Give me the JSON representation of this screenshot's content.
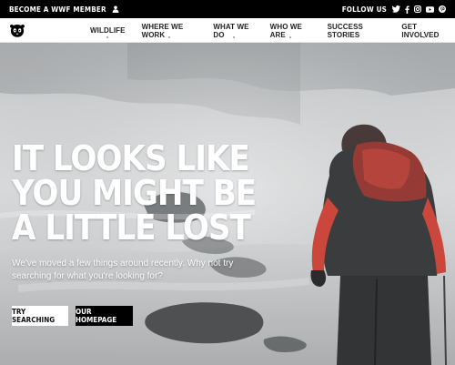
{
  "topbar": {
    "member_label": "BECOME A WWF MEMBER",
    "follow_label": "FOLLOW US",
    "icons": [
      "user-icon",
      "twitter-icon",
      "facebook-icon",
      "instagram-icon",
      "youtube-icon",
      "pinterest-icon"
    ]
  },
  "nav": {
    "items": [
      {
        "label": "WILDLIFE"
      },
      {
        "label": "WHERE WE WORK"
      },
      {
        "label": "WHAT WE DO"
      },
      {
        "label": "WHO WE ARE"
      },
      {
        "label": "SUCCESS STORIES"
      },
      {
        "label": "GET INVOLVED"
      }
    ]
  },
  "hero": {
    "headline": "IT LOOKS LIKE YOU MIGHT BE A LITTLE LOST",
    "subtext": "We've moved a few things around recently. Why not try searching for what you're looking for?",
    "buttons": {
      "search_label": "TRY SEARCHING",
      "home_label": "OUR HOMEPAGE"
    }
  },
  "colors": {
    "topbar_bg": "#000000",
    "nav_bg": "#ffffff",
    "button_dark": "#000000",
    "button_light": "#ffffff"
  }
}
